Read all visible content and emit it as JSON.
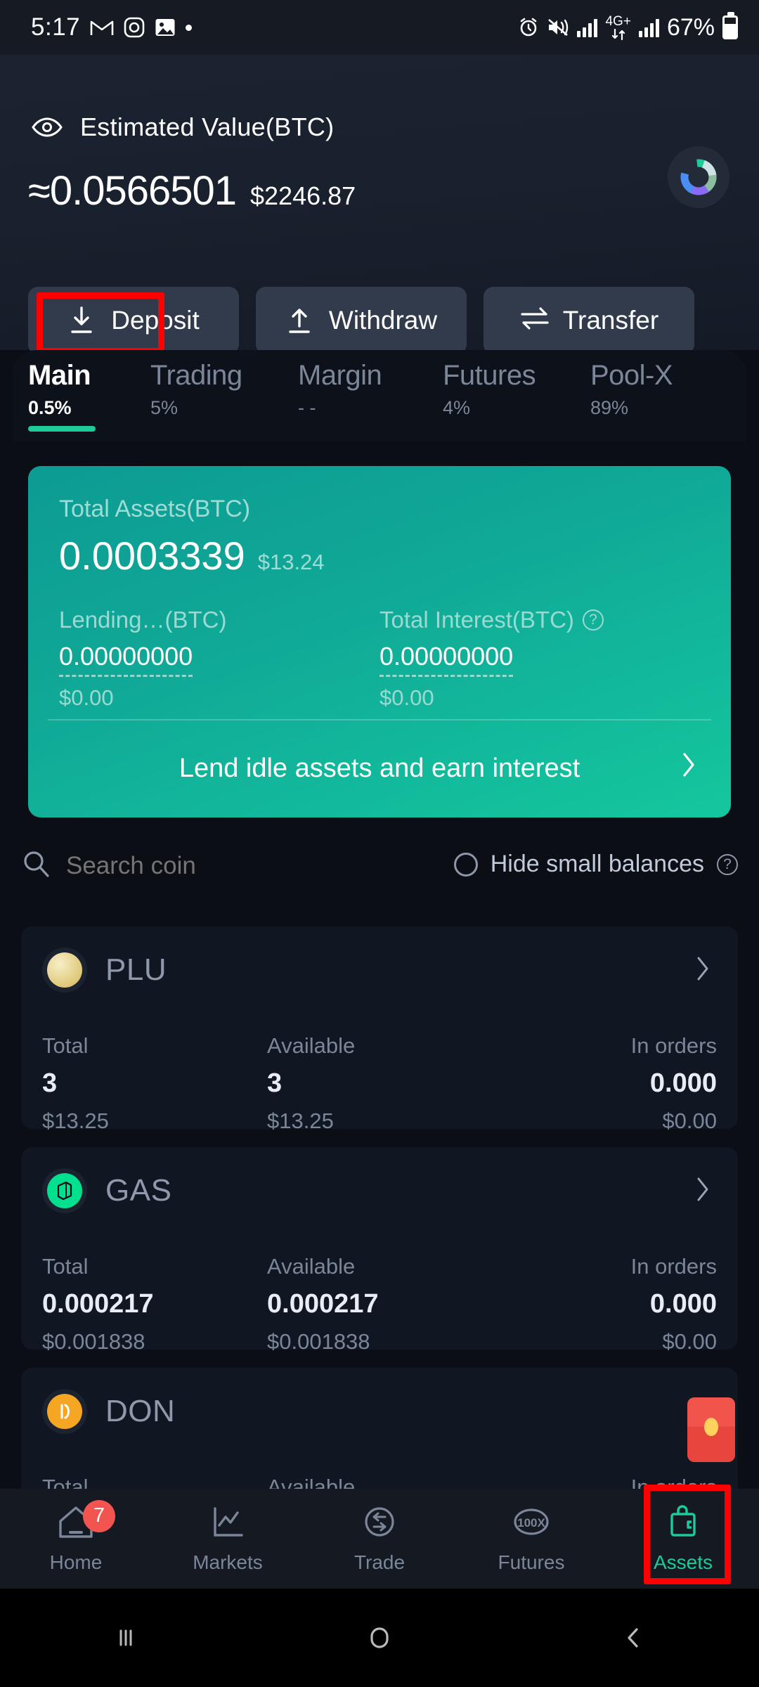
{
  "status_bar": {
    "time": "5:17",
    "left_icons": [
      "gmail-icon",
      "instagram-icon",
      "photos-icon",
      "dot-icon"
    ],
    "right_icons": [
      "alarm-icon",
      "vibrate-icon",
      "signal-icon",
      "data-icon",
      "signal-icon-2"
    ],
    "network_label": "4G+",
    "battery_percent": "67%"
  },
  "header": {
    "eye_icon": "eye-icon",
    "estimated_label": "Estimated Value(BTC)",
    "estimated_btc": "≈0.0566501",
    "estimated_usd": "$2246.87",
    "avatar_icon": "portfolio-donut-icon",
    "actions": [
      {
        "label": "Deposit",
        "icon": "download-arrow-icon",
        "highlighted": true
      },
      {
        "label": "Withdraw",
        "icon": "upload-arrow-icon",
        "highlighted": false
      },
      {
        "label": "Transfer",
        "icon": "transfer-arrows-icon",
        "highlighted": false
      }
    ]
  },
  "tabs": [
    {
      "name": "Main",
      "pct": "0.5",
      "pct_unit": "%",
      "active": true
    },
    {
      "name": "Trading",
      "pct": "5",
      "pct_unit": "%",
      "active": false
    },
    {
      "name": "Margin",
      "pct": "- -",
      "pct_unit": "",
      "active": false
    },
    {
      "name": "Futures",
      "pct": "4",
      "pct_unit": "%",
      "active": false
    },
    {
      "name": "Pool-X",
      "pct": "89",
      "pct_unit": "%",
      "active": false
    }
  ],
  "total_card": {
    "label": "Total Assets(BTC)",
    "value": "0.0003339",
    "usd": "$13.24",
    "lending": {
      "label": "Lending…(BTC)",
      "value": "0.00000000",
      "usd": "$0.00"
    },
    "interest": {
      "label": "Total Interest(BTC)",
      "help_icon": "question-mark-icon",
      "value": "0.00000000",
      "usd": "$0.00"
    },
    "cta_label": "Lend idle assets and earn interest",
    "cta_icon": "chevron-right-icon",
    "accent_color": "#14c79e"
  },
  "filters": {
    "search_icon": "search-icon",
    "search_placeholder": "Search coin",
    "search_value": "",
    "hide_small_balances_label": "Hide small balances",
    "hide_small_balances_checked": false,
    "help_icon": "question-mark-icon"
  },
  "coin_columns": {
    "total": "Total",
    "available": "Available",
    "in_orders": "In orders"
  },
  "coins": [
    {
      "symbol": "PLU",
      "icon": "plu-coin-icon",
      "icon_color": "#e8d79a",
      "chevron": "chevron-right-icon",
      "total": "3",
      "total_usd": "$13.25",
      "available": "3",
      "available_usd": "$13.25",
      "in_orders": "0.000",
      "in_orders_usd": "$0.00"
    },
    {
      "symbol": "GAS",
      "icon": "gas-coin-icon",
      "icon_color": "#00e599",
      "chevron": "chevron-right-icon",
      "total": "0.000217",
      "total_usd": "$0.001838",
      "available": "0.000217",
      "available_usd": "$0.001838",
      "in_orders": "0.000",
      "in_orders_usd": "$0.00"
    },
    {
      "symbol": "DON",
      "icon": "don-coin-icon",
      "icon_color": "#f5a623",
      "chevron": "chevron-right-icon",
      "total": "",
      "total_usd": "",
      "available": "",
      "available_usd": "",
      "in_orders": "",
      "in_orders_usd": ""
    }
  ],
  "red_packet": {
    "icon": "red-packet-icon"
  },
  "bottom_nav": [
    {
      "label": "Home",
      "icon": "home-icon",
      "badge": "7",
      "active": false
    },
    {
      "label": "Markets",
      "icon": "chart-line-icon",
      "badge": "",
      "active": false
    },
    {
      "label": "Trade",
      "icon": "trade-swap-icon",
      "badge": "",
      "active": false
    },
    {
      "label": "Futures",
      "icon": "futures-100x-icon",
      "badge": "",
      "active": false
    },
    {
      "label": "Assets",
      "icon": "wallet-icon",
      "badge": "",
      "active": true,
      "highlighted": true
    }
  ],
  "android_nav": [
    {
      "icon": "recents-icon"
    },
    {
      "icon": "home-circle-icon"
    },
    {
      "icon": "back-icon"
    }
  ],
  "colors": {
    "accent_green": "#1ec99a",
    "highlight_red": "#fe0000",
    "background": "#0b0e14",
    "card": "#111722"
  }
}
